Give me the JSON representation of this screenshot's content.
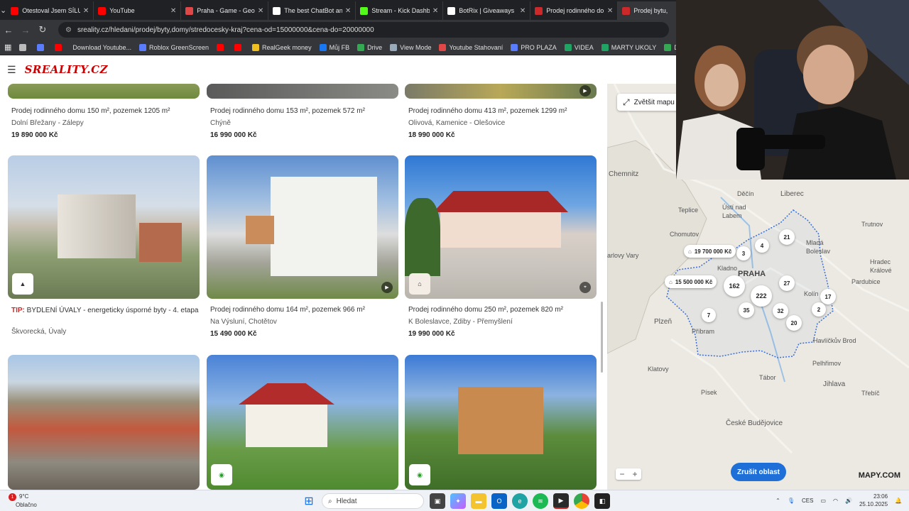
{
  "browser": {
    "tabs": [
      {
        "label": "Otestoval Jsem SÍLU",
        "icon": "youtube-icon",
        "color": "#ff0000"
      },
      {
        "label": "YouTube",
        "icon": "youtube-icon",
        "color": "#ff0000"
      },
      {
        "label": "Praha - Game - GeoG",
        "icon": "map-pin-icon",
        "color": "#e04848"
      },
      {
        "label": "The best ChatBot and",
        "icon": "chatbot-icon",
        "color": "#ffffff"
      },
      {
        "label": "Stream - Kick Dashbo",
        "icon": "kick-icon",
        "color": "#53fc18"
      },
      {
        "label": "BotRix | Giveaways",
        "icon": "botrix-icon",
        "color": "#ffffff"
      },
      {
        "label": "Prodej rodinného do",
        "icon": "sreality-icon",
        "color": "#cc2a2a"
      },
      {
        "label": "Prodej bytu,",
        "icon": "sreality-icon",
        "color": "#cc2a2a",
        "active": true
      }
    ],
    "url": "sreality.cz/hledani/prodej/byty,domy/stredocesky-kraj?cena-od=15000000&cena-do=20000000",
    "bookmarks": [
      {
        "label": "",
        "icon": "globe-icon",
        "color": "#bbbbbb"
      },
      {
        "label": "",
        "icon": "bookmark-icon",
        "color": "#5a7cff"
      },
      {
        "label": "",
        "icon": "youtube-icon",
        "color": "#ff0000"
      },
      {
        "label": "Download Youtube...",
        "icon": "",
        "color": "#35363a"
      },
      {
        "label": "Roblox GreenScreen",
        "icon": "roblox-icon",
        "color": "#5a7cff"
      },
      {
        "label": "",
        "icon": "youtube-icon",
        "color": "#ff0000"
      },
      {
        "label": "",
        "icon": "youtube-icon",
        "color": "#ff0000"
      },
      {
        "label": "RealGeek money",
        "icon": "coin-icon",
        "color": "#f0c020"
      },
      {
        "label": "Můj FB",
        "icon": "facebook-icon",
        "color": "#1877f2"
      },
      {
        "label": "Drive",
        "icon": "drive-icon",
        "color": "#34a853"
      },
      {
        "label": "View Mode",
        "icon": "view-icon",
        "color": "#9ab"
      },
      {
        "label": "Youtube Stahovaní",
        "icon": "download-icon",
        "color": "#e04848"
      },
      {
        "label": "PRO PLAZA",
        "icon": "plaza-icon",
        "color": "#5a7cff"
      },
      {
        "label": "VIDEA",
        "icon": "sheets-icon",
        "color": "#1fa463"
      },
      {
        "label": "MARTY UKOLY",
        "icon": "sheets-icon",
        "color": "#1fa463"
      },
      {
        "label": "Dodo videa",
        "icon": "drive-icon",
        "color": "#34a853"
      }
    ]
  },
  "site": {
    "logo": "SREALITY.CZ"
  },
  "listings": {
    "row1": [
      {
        "title": "Prodej rodinného domu 150 m², pozemek 1205 m²",
        "location": "Dolní Břežany - Zálepy",
        "price": "19 890 000 Kč"
      },
      {
        "title": "Prodej rodinného domu 153 m², pozemek 572 m²",
        "location": "Chýně",
        "price": "16 990 000 Kč"
      },
      {
        "title": "Prodej rodinného domu 413 m², pozemek 1299 m²",
        "location": "Olivová, Kamenice - Olešovice",
        "price": "18 990 000 Kč"
      }
    ],
    "row2": [
      {
        "tip_prefix": "TIP:",
        "title": "BYDLENÍ ÚVALY - energeticky úsporné byty - 4. etapa",
        "location": "Škvorecká, Úvaly",
        "price": ""
      },
      {
        "title": "Prodej rodinného domu 164 m², pozemek 966 m²",
        "location": "Na Výsluní, Chotětov",
        "price": "15 490 000 Kč"
      },
      {
        "title": "Prodej rodinného domu 250 m², pozemek 820 m²",
        "location": "K Boleslavce, Zdiby - Přemyšlení",
        "price": "19 990 000 Kč"
      }
    ]
  },
  "map": {
    "enlarge_label": "Zvětšit mapu",
    "cancel_label": "Zrušit oblast",
    "brand": "MAPY.COM",
    "cities": [
      "Chemnitz",
      "Děčín",
      "Liberec",
      "Teplice",
      "Ústí nad Labem",
      "Chomutov",
      "Trutnov",
      "Mladá Boleslav",
      "arlovy Vary",
      "Kladno",
      "PRAHA",
      "Hradec Králové",
      "Pardubice",
      "Kolín",
      "Plzeň",
      "Příbram",
      "Havlíčkův Brod",
      "Klatovy",
      "Pelhřimov",
      "Jihlava",
      "Tábor",
      "Třebíč",
      "Písek",
      "České Budějovice"
    ],
    "clusters": [
      "3",
      "4",
      "21",
      "162",
      "222",
      "27",
      "17",
      "35",
      "32",
      "2",
      "7",
      "20"
    ],
    "price_tags": [
      "19 700 000 Kč",
      "15 500 000 Kč"
    ]
  },
  "taskbar": {
    "temperature": "9°C",
    "weather": "Oblačno",
    "notification_count": "1",
    "search_placeholder": "Hledat",
    "language": "CES",
    "time": "23:06",
    "date": "25.10.2025"
  },
  "colors": {
    "accent": "#cc2a2a",
    "map_button": "#1e6fd8",
    "region_outline": "#3a6fd8"
  }
}
